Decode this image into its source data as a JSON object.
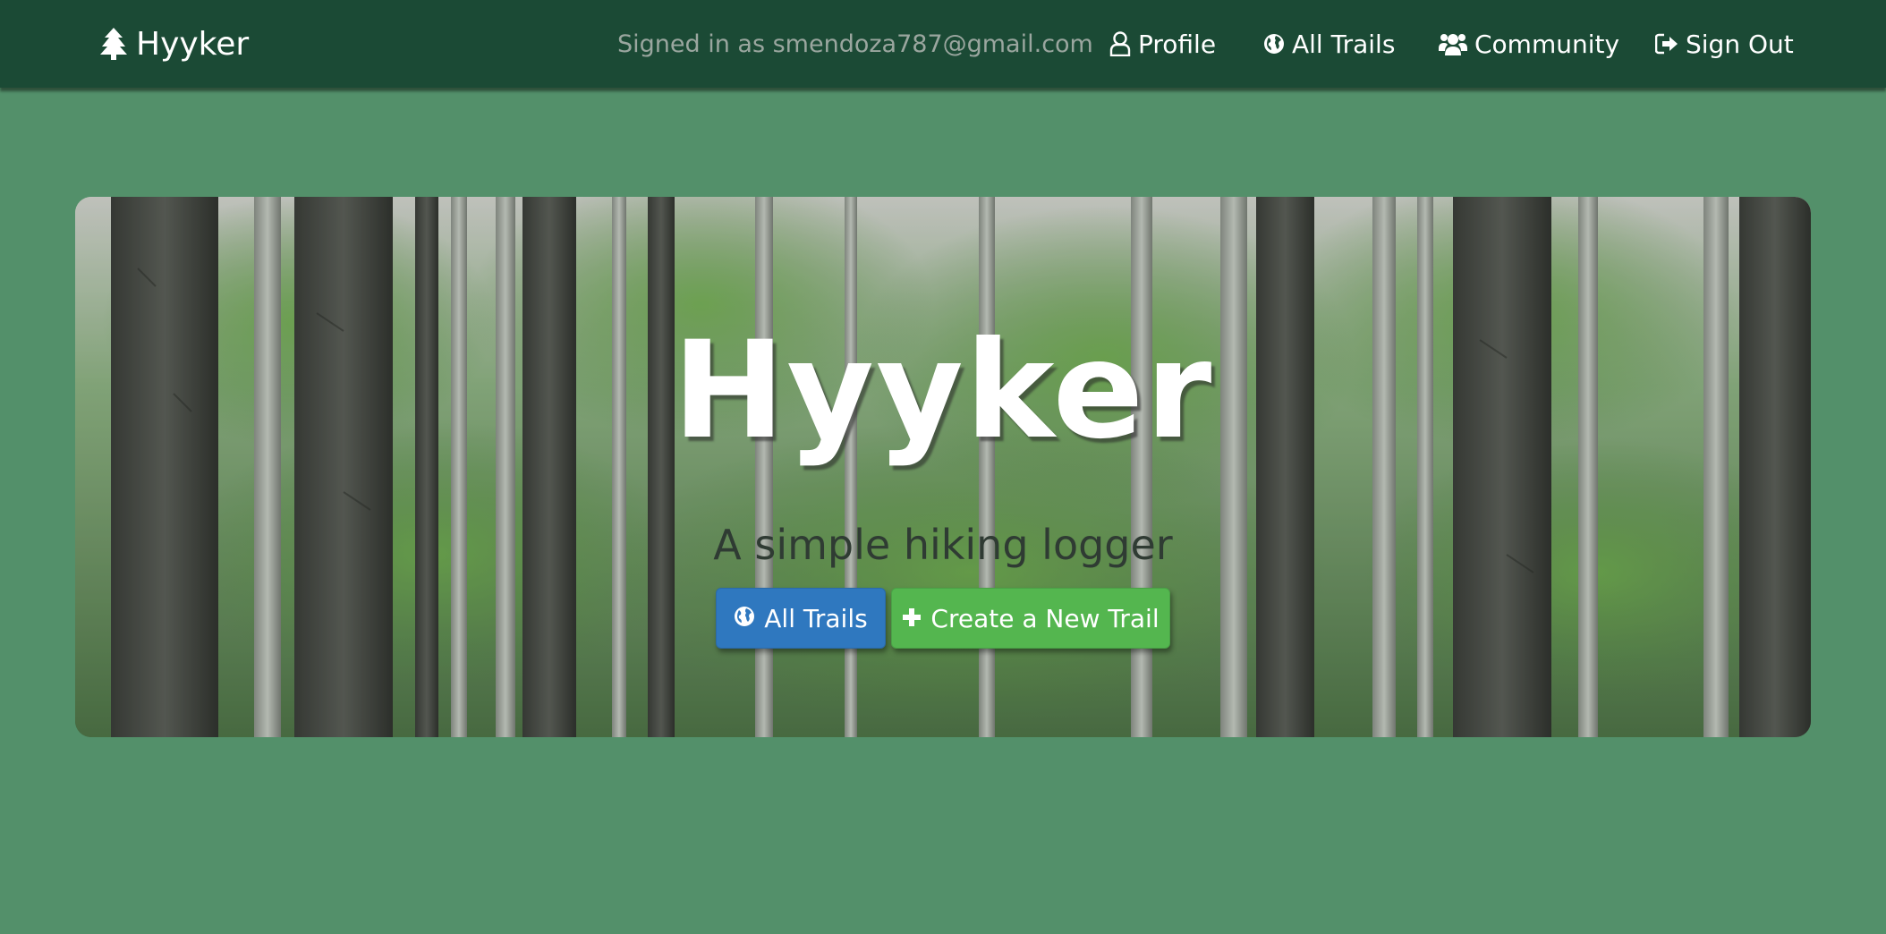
{
  "navbar": {
    "brand": "Hyyker",
    "signed_in_text": "Signed in as smendoza787@gmail.com",
    "links": {
      "profile": "Profile",
      "all_trails": "All Trails",
      "community": "Community",
      "sign_out": "Sign Out"
    }
  },
  "hero": {
    "title": "Hyyker",
    "subtitle": "A simple hiking logger",
    "buttons": {
      "all_trails": "All Trails",
      "create_trail": "Create a New Trail"
    }
  },
  "icons": {
    "brand": "tree-icon",
    "profile": "user-icon",
    "all_trails": "globe-icon",
    "community": "users-icon",
    "sign_out": "sign-out-icon",
    "create": "plus-icon"
  },
  "colors": {
    "page_bg": "#53906a",
    "navbar_bg": "#1b4a35",
    "btn_primary": "#2f78bf",
    "btn_success": "#54b64f"
  }
}
